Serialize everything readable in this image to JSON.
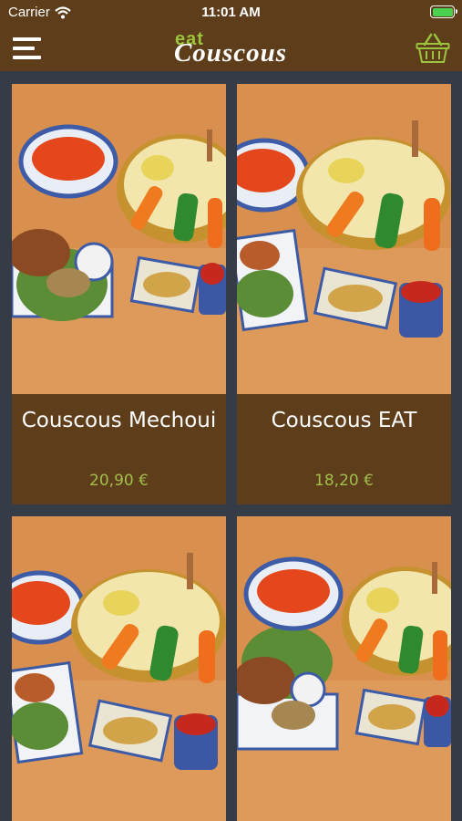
{
  "status_bar": {
    "carrier": "Carrier",
    "time": "11:01 AM"
  },
  "header": {
    "logo_small": "eat",
    "logo_main": "Couscous"
  },
  "products": [
    {
      "name": "Couscous Mechoui",
      "price": "20,90 €"
    },
    {
      "name": "Couscous EAT",
      "price": "18,20 €"
    },
    {
      "name": "",
      "price": ""
    },
    {
      "name": "",
      "price": ""
    }
  ],
  "colors": {
    "header": "#5d3d1a",
    "background": "#363b48",
    "price": "#a2be4b",
    "accent": "#9cc53d"
  },
  "icons": [
    "wifi-icon",
    "battery-icon",
    "menu-icon",
    "basket-icon"
  ]
}
